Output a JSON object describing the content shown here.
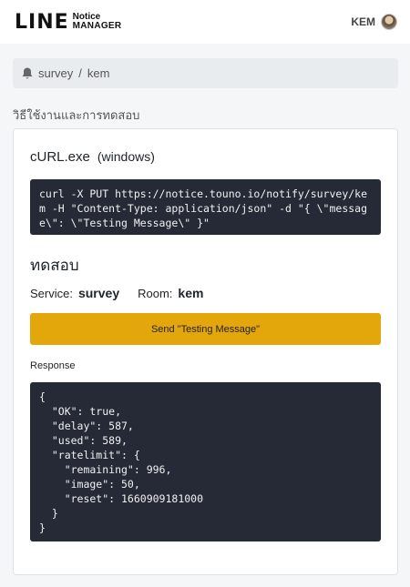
{
  "navbar": {
    "brand_main": "LINE",
    "brand_notice": "Notice",
    "brand_manager": "MANAGER",
    "user_name": "KEM"
  },
  "breadcrumb": {
    "icon": "bell-icon",
    "service": "survey",
    "separator": "/",
    "room": "kem"
  },
  "section_title": "วิธีใช้งานและการทดสอบ",
  "curl": {
    "title": "cURL.exe",
    "os": "(windows)",
    "command": "curl -X PUT https://notice.touno.io/notify/survey/kem -H \"Content-Type: application/json\" -d \"{ \\\"message\\\": \\\"Testing Message\\\" }\""
  },
  "test": {
    "title": "ทดสอบ",
    "service_label": "Service:",
    "service_value": "survey",
    "room_label": "Room:",
    "room_value": "kem",
    "send_button": "Send \"Testing Message\""
  },
  "response": {
    "label": "Response",
    "body": "{\n  \"OK\": true,\n  \"delay\": 587,\n  \"used\": 589,\n  \"ratelimit\": {\n    \"remaining\": 996,\n    \"image\": 50,\n    \"reset\": 1660909181000\n  }\n}"
  },
  "colors": {
    "accent": "#e3a60b",
    "code_bg": "#252a36"
  }
}
